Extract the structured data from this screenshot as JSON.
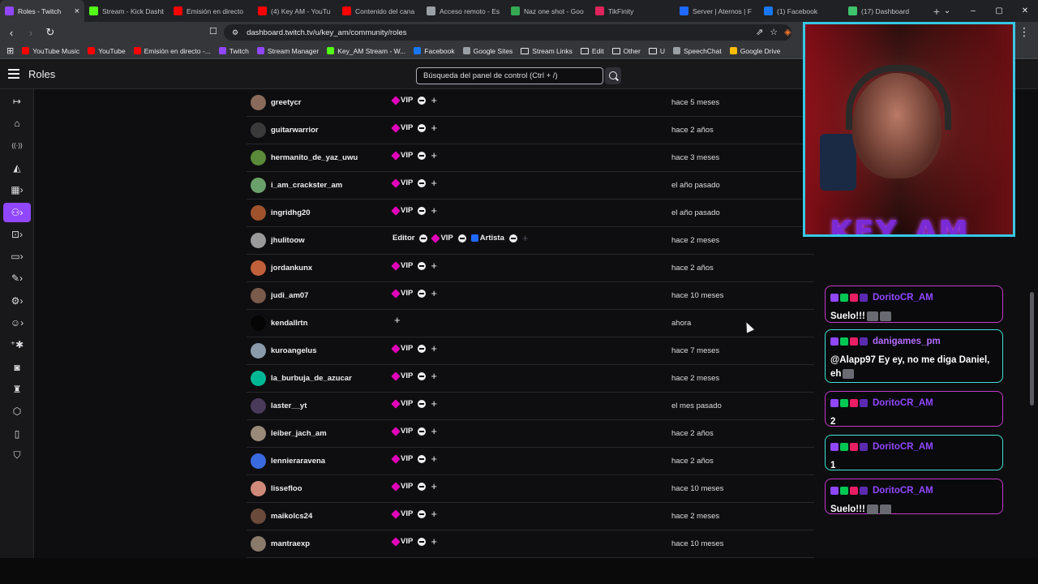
{
  "browser": {
    "tabs": [
      {
        "title": "Roles - Twitch",
        "color": "#9147ff",
        "active": true
      },
      {
        "title": "Stream - Kick Dashb",
        "color": "#53fc18"
      },
      {
        "title": "Emisión en directo",
        "color": "#ff0000"
      },
      {
        "title": "(4) Key AM - YouTu",
        "color": "#ff0000"
      },
      {
        "title": "Contenido del cana",
        "color": "#ff0000"
      },
      {
        "title": "Acceso remoto - Es",
        "color": "#9aa0a6"
      },
      {
        "title": "Naz one shot - Goo",
        "color": "#34a853"
      },
      {
        "title": "TikFinity",
        "color": "#e0245e"
      },
      {
        "title": "Server | Aternos | F",
        "color": "#1f69ff"
      },
      {
        "title": "(1) Facebook",
        "color": "#1877f2"
      },
      {
        "title": "(17) Dashboard",
        "color": "#3ec46d"
      }
    ],
    "tab_close": "×",
    "new_tab": "+",
    "window_controls": [
      "⌄",
      "–",
      "▢",
      "✕"
    ],
    "url": "dashboard.twitch.tv/u/key_am/community/roles",
    "bookmarks": [
      {
        "label": "YouTube Music",
        "color": "#ff0000"
      },
      {
        "label": "YouTube",
        "color": "#ff0000"
      },
      {
        "label": "Emisión en directo -...",
        "color": "#ff0000"
      },
      {
        "label": "Twitch",
        "color": "#9147ff"
      },
      {
        "label": "Stream Manager",
        "color": "#9147ff"
      },
      {
        "label": "Key_AM Stream - W...",
        "color": "#53fc18"
      },
      {
        "label": "Facebook",
        "color": "#1877f2"
      },
      {
        "label": "Google Sites",
        "color": "#9aa0a6"
      },
      {
        "label": "Stream Links",
        "folder": true
      },
      {
        "label": "Edit",
        "folder": true
      },
      {
        "label": "Other",
        "folder": true
      },
      {
        "label": "U",
        "folder": true
      },
      {
        "label": "SpeechChat",
        "color": "#9aa0a6"
      },
      {
        "label": "Google Drive",
        "color": "#fbbc04"
      }
    ]
  },
  "twitch": {
    "page_title": "Roles",
    "search_placeholder": "Búsqueda del panel de control (Ctrl + /)"
  },
  "nav_icons": [
    "collapse-icon",
    "home-icon",
    "broadcast-icon",
    "megaphone-icon",
    "analytics-icon",
    "community-icon",
    "content-icon",
    "monetization-icon",
    "creator-tools-icon",
    "settings-icon",
    "viewer-rewards-icon",
    "add-user-icon",
    "camera-icon",
    "trophy-icon",
    "extensions-icon",
    "learn-icon",
    "safety-icon"
  ],
  "nav_glyphs": [
    "↦",
    "⌂",
    "((·))",
    "◭",
    "▦›",
    "⚇›",
    "⊡›",
    "▭›",
    "✎›",
    "⚙›",
    "☺›",
    "⁺✱",
    "◙",
    "♜",
    "⬡",
    "▯",
    "⛉"
  ],
  "roles_table": [
    {
      "user": "greetycr",
      "roles": [
        {
          "label": "VIP",
          "type": "vip"
        }
      ],
      "when": "hace 5 meses",
      "avatar": "#8a6a5a"
    },
    {
      "user": "guitarwarrior",
      "roles": [
        {
          "label": "VIP",
          "type": "vip"
        }
      ],
      "when": "hace 2 años",
      "avatar": "#3a3a3a"
    },
    {
      "user": "hermanito_de_yaz_uwu",
      "roles": [
        {
          "label": "VIP",
          "type": "vip"
        }
      ],
      "when": "hace 3 meses",
      "avatar": "#5a8a3a"
    },
    {
      "user": "i_am_crackster_am",
      "roles": [
        {
          "label": "VIP",
          "type": "vip"
        }
      ],
      "when": "el año pasado",
      "avatar": "#6aa06a"
    },
    {
      "user": "ingridhg20",
      "roles": [
        {
          "label": "VIP",
          "type": "vip"
        }
      ],
      "when": "el año pasado",
      "avatar": "#a0522d"
    },
    {
      "user": "jhulitoow",
      "roles": [
        {
          "label": "Editor",
          "type": "editor"
        },
        {
          "label": "VIP",
          "type": "vip"
        },
        {
          "label": "Artista",
          "type": "artist"
        }
      ],
      "plus_dim": true,
      "when": "hace 2 meses",
      "avatar": "#9a9a9a"
    },
    {
      "user": "jordankunx",
      "roles": [
        {
          "label": "VIP",
          "type": "vip"
        }
      ],
      "when": "hace 2 años",
      "avatar": "#c0603a"
    },
    {
      "user": "judi_am07",
      "roles": [
        {
          "label": "VIP",
          "type": "vip"
        }
      ],
      "when": "hace 10 meses",
      "avatar": "#7a5a4a"
    },
    {
      "user": "kendallrtn",
      "roles": [],
      "when": "ahora",
      "avatar": "#050505"
    },
    {
      "user": "kuroangelus",
      "roles": [
        {
          "label": "VIP",
          "type": "vip"
        }
      ],
      "when": "hace 7 meses",
      "avatar": "#8a9aaa"
    },
    {
      "user": "la_burbuja_de_azucar",
      "roles": [
        {
          "label": "VIP",
          "type": "vip"
        }
      ],
      "when": "hace 2 meses",
      "avatar": "#00b894"
    },
    {
      "user": "laster__yt",
      "roles": [
        {
          "label": "VIP",
          "type": "vip"
        }
      ],
      "when": "el mes pasado",
      "avatar": "#4a3a5a"
    },
    {
      "user": "leiber_jach_am",
      "roles": [
        {
          "label": "VIP",
          "type": "vip"
        }
      ],
      "when": "hace 2 años",
      "avatar": "#9a8a7a"
    },
    {
      "user": "lennieraravena",
      "roles": [
        {
          "label": "VIP",
          "type": "vip"
        }
      ],
      "when": "hace 2 años",
      "avatar": "#3a6ae0"
    },
    {
      "user": "lissefloo",
      "roles": [
        {
          "label": "VIP",
          "type": "vip"
        }
      ],
      "when": "hace 10 meses",
      "avatar": "#d08a7a"
    },
    {
      "user": "maikolcs24",
      "roles": [
        {
          "label": "VIP",
          "type": "vip"
        }
      ],
      "when": "hace 2 meses",
      "avatar": "#6a4a3a"
    },
    {
      "user": "mantraexp",
      "roles": [
        {
          "label": "VIP",
          "type": "vip"
        }
      ],
      "when": "hace 10 meses",
      "avatar": "#8a7a6a"
    }
  ],
  "stream": {
    "logo_text": "KEY_AM",
    "chat": [
      {
        "user": "DoritoCR_AM",
        "text": "Suelo!!!",
        "emotes": 2,
        "style": "pink"
      },
      {
        "user": "danigames_pm",
        "text": "@Alapp97 Ey ey, no me diga Daniel, eh",
        "emotes": 1,
        "style": "teal"
      },
      {
        "user": "DoritoCR_AM",
        "text": "2",
        "emotes": 0,
        "style": "pink"
      },
      {
        "user": "DoritoCR_AM",
        "text": "1",
        "emotes": 0,
        "style": "teal"
      },
      {
        "user": "DoritoCR_AM",
        "text": "Suelo!!!",
        "emotes": 2,
        "style": "pink"
      }
    ]
  }
}
